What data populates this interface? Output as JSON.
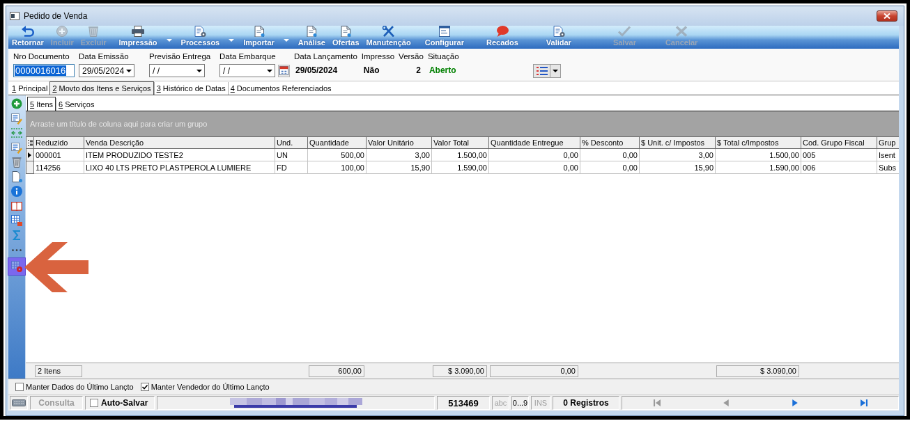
{
  "window": {
    "title": "Pedido de Venda"
  },
  "toolbar": [
    {
      "label": "Retornar",
      "disabled": false,
      "menu": false
    },
    {
      "label": "Incluir",
      "disabled": true,
      "menu": false
    },
    {
      "label": "Excluir",
      "disabled": true,
      "menu": false
    },
    {
      "label": "Impressão",
      "disabled": false,
      "menu": true
    },
    {
      "label": "Processos",
      "disabled": false,
      "menu": true
    },
    {
      "label": "Importar",
      "disabled": false,
      "menu": true
    },
    {
      "label": "Análise",
      "disabled": false,
      "menu": false
    },
    {
      "label": "Ofertas",
      "disabled": false,
      "menu": false
    },
    {
      "label": "Manutenção",
      "disabled": false,
      "menu": false
    },
    {
      "label": "Configurar",
      "disabled": false,
      "menu": false
    },
    {
      "label": "Recados",
      "disabled": false,
      "menu": false
    },
    {
      "label": "Validar",
      "disabled": false,
      "menu": false
    },
    {
      "label": "Salvar",
      "disabled": true,
      "menu": false
    },
    {
      "label": "Cancelar",
      "disabled": true,
      "menu": false
    }
  ],
  "fields": [
    {
      "kind": "input",
      "label": "Nro Documento",
      "value": "0000016016",
      "focused": true
    },
    {
      "kind": "dropdown",
      "label": "Data Emissão",
      "value": "29/05/2024"
    },
    {
      "kind": "dropdown",
      "label": "Previsão Entrega",
      "value": "/ /"
    },
    {
      "kind": "dropdown",
      "label": "Data Embarque",
      "value": "/ /",
      "calendar": true
    },
    {
      "kind": "text",
      "label": "Data Lançamento",
      "value": "29/05/2024"
    },
    {
      "kind": "text",
      "label": "Impresso",
      "value": "Não"
    },
    {
      "kind": "text",
      "label": "Versão",
      "value": "2"
    },
    {
      "kind": "text",
      "label": "Situação",
      "value": "Aberto",
      "color": "#008000"
    }
  ],
  "tabs": [
    {
      "label": "1 Principal",
      "selected": false
    },
    {
      "label": "2 Movto dos Itens e Serviços",
      "selected": true
    },
    {
      "label": "3 Histórico de Datas",
      "selected": false
    },
    {
      "label": "4 Documentos Referenciados",
      "selected": false
    }
  ],
  "side_toolbar": [
    {
      "selected": false
    },
    {
      "selected": false
    },
    {
      "selected": false
    },
    {
      "selected": false
    },
    {
      "selected": false
    },
    {
      "selected": false
    },
    {
      "selected": false
    },
    {
      "selected": false
    },
    {
      "selected": false
    },
    {
      "selected": false
    },
    {
      "selected": false
    },
    {
      "selected": true
    }
  ],
  "subtabs": [
    {
      "label": "5 Itens",
      "selected": true
    },
    {
      "label": "6 Serviços",
      "selected": false
    }
  ],
  "grid": {
    "group_hint": "Arraste um título de coluna aqui para criar um grupo",
    "columns": [
      {
        "label": "Reduzido",
        "kind": "text",
        "total": "2 Itens"
      },
      {
        "label": "Venda Descrição",
        "kind": "text"
      },
      {
        "label": "Und.",
        "kind": "text"
      },
      {
        "label": "Quantidade",
        "kind": "number",
        "total": "600,00"
      },
      {
        "label": "Valor Unitário",
        "kind": "number"
      },
      {
        "label": "Valor Total",
        "kind": "number",
        "total": "$ 3.090,00"
      },
      {
        "label": "Quantidade Entregue",
        "kind": "number",
        "total": "0,00"
      },
      {
        "label": "% Desconto",
        "kind": "number"
      },
      {
        "label": "$ Unit. c/ Impostos",
        "kind": "number"
      },
      {
        "label": "$ Total c/Impostos",
        "kind": "number",
        "total": "$ 3.090,00"
      },
      {
        "label": "Cod. Grupo Fiscal",
        "kind": "text"
      },
      {
        "label": "Grup",
        "kind": "text"
      }
    ],
    "rows": [
      {
        "current": true,
        "cells": [
          "000001",
          "ITEM PRODUZIDO TESTE2",
          "UN",
          "500,00",
          "3,00",
          "1.500,00",
          "0,00",
          "0,00",
          "3,00",
          "1.500,00",
          "005",
          "Isent"
        ]
      },
      {
        "current": false,
        "cells": [
          "114256",
          "LIXO 40 LTS PRETO PLASTPEROLA LUMIERE",
          "FD",
          "100,00",
          "15,90",
          "1.590,00",
          "0,00",
          "0,00",
          "15,90",
          "1.590,00",
          "006",
          "Subs"
        ]
      }
    ]
  },
  "options": [
    {
      "label": "Manter Dados do Último Lançto",
      "checked": false
    },
    {
      "label": "Manter Vendedor do Último Lançto",
      "checked": true
    }
  ],
  "status_bar": {
    "mode": {
      "label": "Consulta",
      "disabled": true
    },
    "auto_save": {
      "label": "Auto-Salvar",
      "checked": false
    },
    "code": "513469",
    "indicators": [
      {
        "label": "abc",
        "active": false
      },
      {
        "label": "0...9",
        "active": true
      },
      {
        "label": "INS",
        "active": false
      }
    ],
    "records": "0 Registros",
    "navigation": [
      {
        "disabled": true
      },
      {
        "disabled": true
      },
      {
        "disabled": false
      },
      {
        "disabled": false
      }
    ]
  }
}
